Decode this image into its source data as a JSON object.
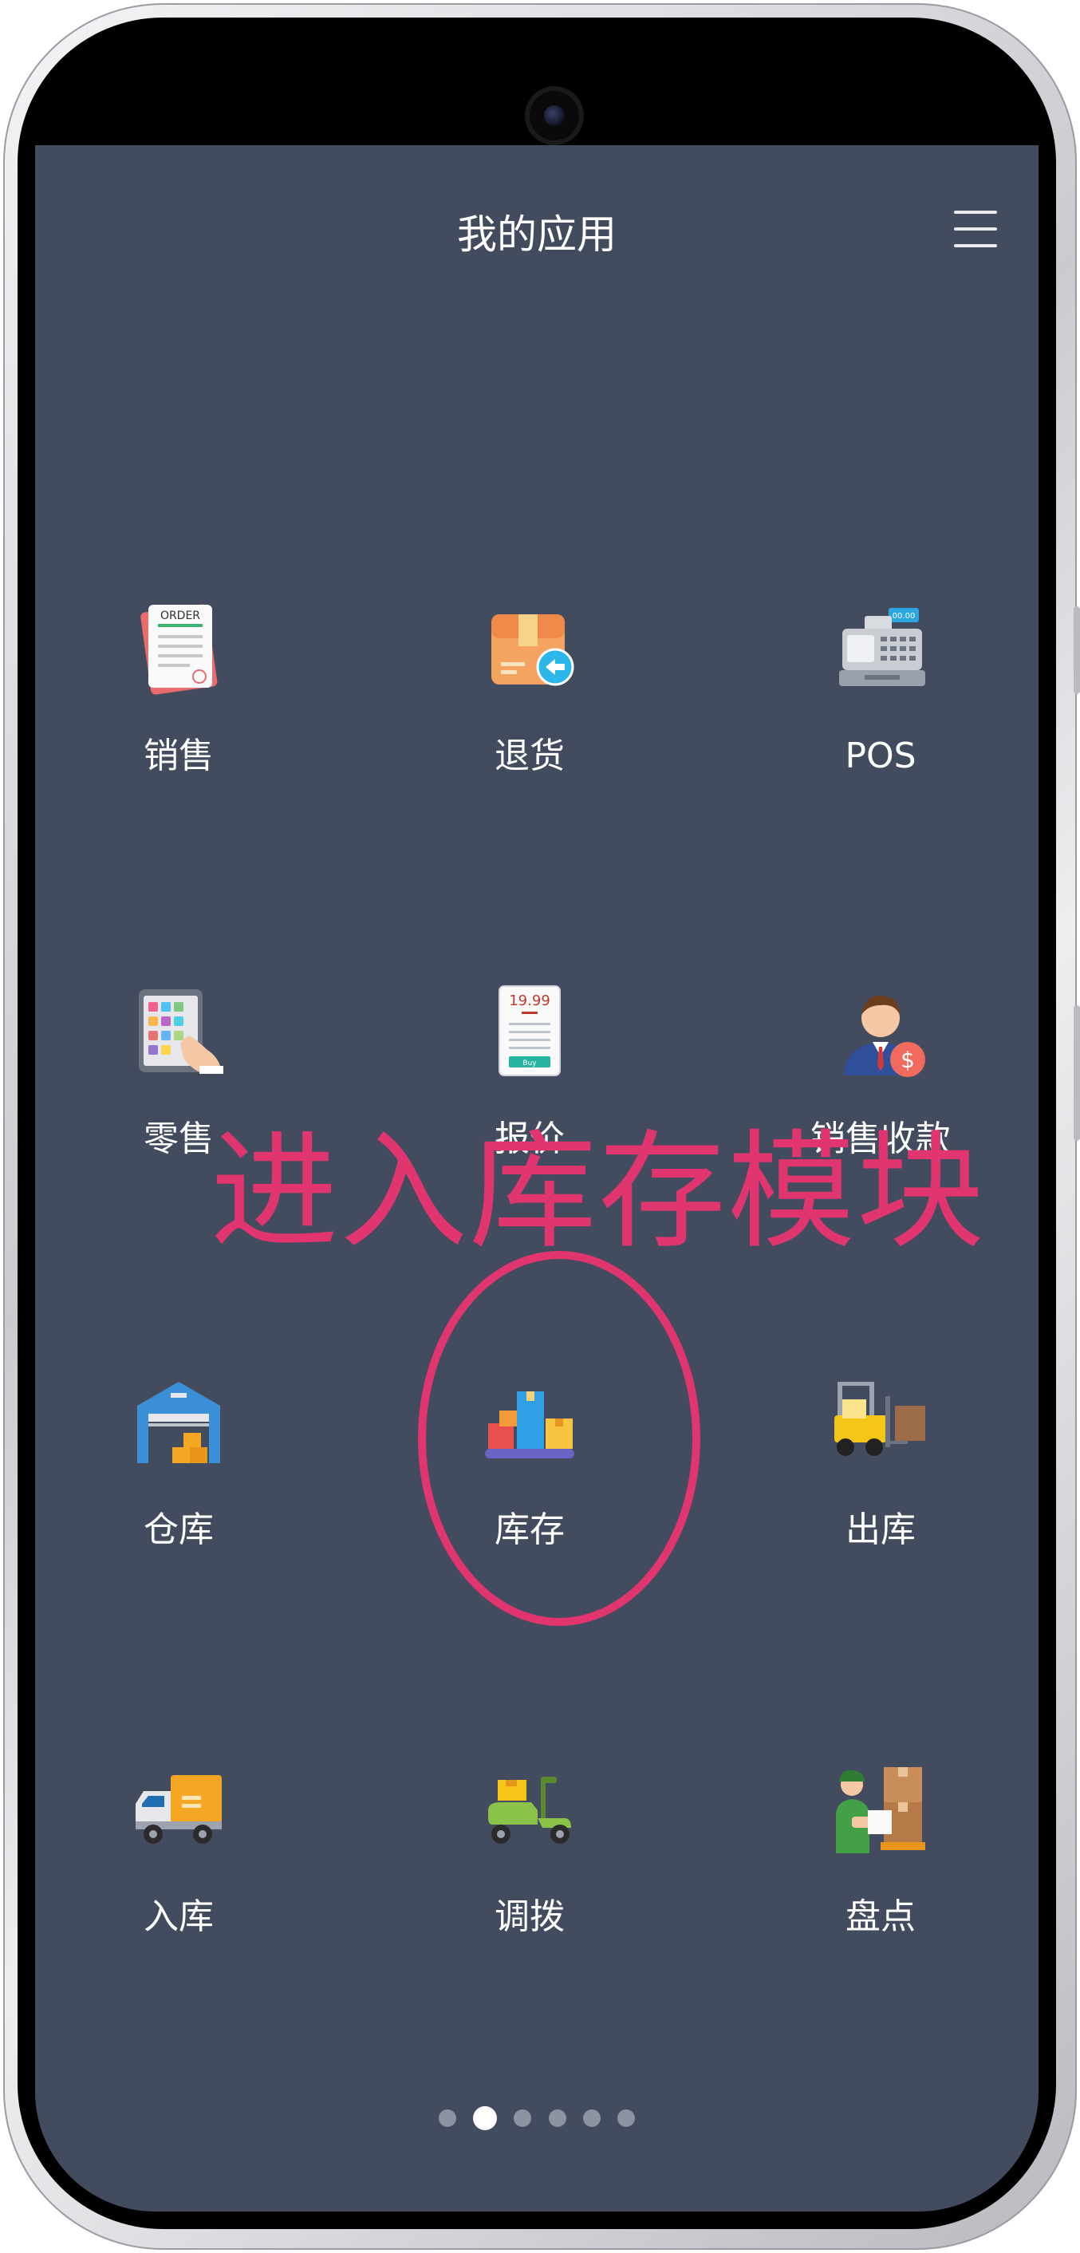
{
  "header": {
    "title": "我的应用",
    "menu_icon": "hamburger-menu-icon"
  },
  "apps": [
    {
      "label": "销售",
      "icon": "order-document-icon"
    },
    {
      "label": "退货",
      "icon": "return-box-icon"
    },
    {
      "label": "POS",
      "icon": "cash-register-icon"
    },
    {
      "label": "零售",
      "icon": "tablet-keypad-icon"
    },
    {
      "label": "报价",
      "icon": "price-tag-icon"
    },
    {
      "label": "销售收款",
      "icon": "salesman-payment-icon"
    },
    {
      "label": "仓库",
      "icon": "warehouse-icon"
    },
    {
      "label": "库存",
      "icon": "inventory-boxes-icon"
    },
    {
      "label": "出库",
      "icon": "forklift-icon"
    },
    {
      "label": "入库",
      "icon": "delivery-truck-icon"
    },
    {
      "label": "调拨",
      "icon": "scooter-icon"
    },
    {
      "label": "盘点",
      "icon": "stocktaking-worker-icon"
    }
  ],
  "annotation": {
    "text": "进入库存模块",
    "color": "#e0356f"
  },
  "pagination": {
    "total": 6,
    "active_index": 1
  },
  "colors": {
    "screen_bg": "#434c5e",
    "accent": "#e0356f"
  }
}
